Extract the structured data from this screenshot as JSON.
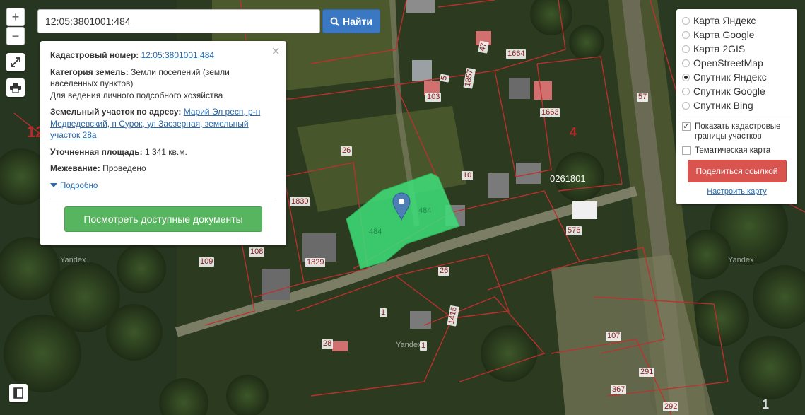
{
  "search": {
    "value": "12:05:3801001:484",
    "button_label": "Найти"
  },
  "zoom": {
    "in_label": "+",
    "out_label": "−"
  },
  "popup": {
    "cadastral_label": "Кадастровый номер:",
    "cadastral_value": "12:05:3801001:484",
    "category_label": "Категория земель:",
    "category_value": "Земли поселений (земли населенных пунктов)",
    "category_use": "Для ведения личного подсобного хозяйства",
    "address_label": "Земельный участок по адресу:",
    "address_value": "Марий Эл респ, р-н Медведевский, п Сурок, ул Заозерная, земельный участок 28а",
    "area_label": "Уточненная площадь:",
    "area_value": "1 341 кв.м.",
    "survey_label": "Межевание:",
    "survey_value": "Проведено",
    "details_label": "Подробно",
    "docs_button": "Посмотреть доступные документы",
    "close": "×"
  },
  "layers": {
    "options": [
      {
        "label": "Карта Яндекс",
        "selected": false
      },
      {
        "label": "Карта Google",
        "selected": false
      },
      {
        "label": "Карта 2GIS",
        "selected": false
      },
      {
        "label": "OpenStreetMap",
        "selected": false
      },
      {
        "label": "Спутник Яндекс",
        "selected": true
      },
      {
        "label": "Спутник Google",
        "selected": false
      },
      {
        "label": "Спутник Bing",
        "selected": false
      }
    ],
    "show_borders_label": "Показать кадастровые границы участков",
    "show_borders_checked": true,
    "thematic_label": "Тематическая карта",
    "thematic_checked": false,
    "share_button": "Поделиться ссылкой",
    "setup_link": "Настроить карту"
  },
  "map": {
    "parcel_labels": [
      "1664",
      "1857",
      "103",
      "1663",
      "57",
      "4",
      "26",
      "10",
      "0261801",
      "1830",
      "576",
      "108",
      "109",
      "1829",
      "26",
      "1",
      "1415",
      "28",
      "1",
      "107",
      "291",
      "367",
      "292",
      "12",
      "484",
      "484",
      "4",
      "47",
      "5",
      "1"
    ],
    "watermarks": [
      "Yandex",
      "Yandex",
      "Yandex"
    ],
    "highlight_color": "#3ee07a",
    "border_color": "#c0302f"
  }
}
